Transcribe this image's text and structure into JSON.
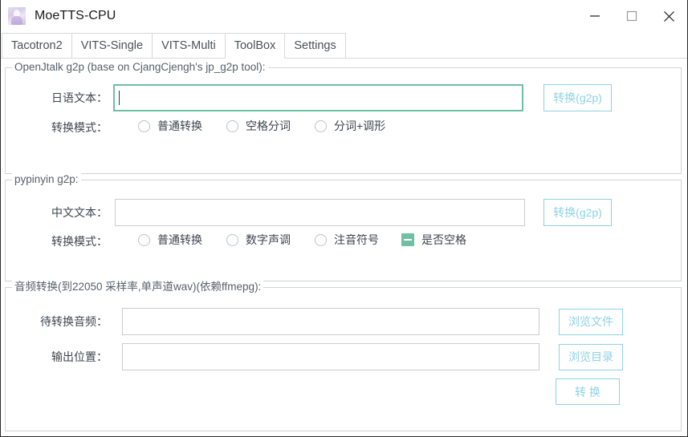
{
  "window": {
    "title": "MoeTTS-CPU",
    "icon": "anime-avatar-icon",
    "minimize_label": "minimize-icon",
    "maximize_label": "maximize-icon",
    "close_label": "close-icon"
  },
  "colors": {
    "accent_teal": "#6fbfa5",
    "accent_cyan": "#8ed2e6",
    "border_gray": "#d0d3d6",
    "text_gray": "#3d4550"
  },
  "tabs": [
    {
      "label": "Tacotron2",
      "active": false
    },
    {
      "label": "VITS-Single",
      "active": false
    },
    {
      "label": "VITS-Multi",
      "active": false
    },
    {
      "label": "ToolBox",
      "active": true
    },
    {
      "label": "Settings",
      "active": false
    }
  ],
  "groups": {
    "openjtalk": {
      "title": "OpenJtalk g2p (base on CjangCjengh's jp_g2p tool):",
      "text_label": "日语文本：",
      "text_value": "",
      "text_placeholder": "",
      "convert_button": "转换(g2p)",
      "mode_label": "转换模式：",
      "modes": [
        {
          "label": "普通转换",
          "selected": false
        },
        {
          "label": "空格分词",
          "selected": false
        },
        {
          "label": "分词+调形",
          "selected": false
        }
      ]
    },
    "pypinyin": {
      "title": "pypinyin g2p:",
      "text_label": "中文文本：",
      "text_value": "",
      "text_placeholder": "",
      "convert_button": "转换(g2p)",
      "mode_label": "转换模式：",
      "modes": [
        {
          "label": "普通转换",
          "selected": false
        },
        {
          "label": "数字声调",
          "selected": false
        },
        {
          "label": "注音符号",
          "selected": false
        }
      ],
      "space_checkbox": {
        "label": "是否空格",
        "state": "indeterminate"
      }
    },
    "audio": {
      "title": "音频转换(到22050 采样率,单声道wav)(依赖ffmepg):",
      "source_label": "待转换音频：",
      "source_value": "",
      "source_placeholder": "",
      "browse_file_button": "浏览文件",
      "output_label": "输出位置：",
      "output_value": "",
      "output_placeholder": "",
      "browse_dir_button": "浏览目录",
      "convert_button": "转 换"
    }
  }
}
